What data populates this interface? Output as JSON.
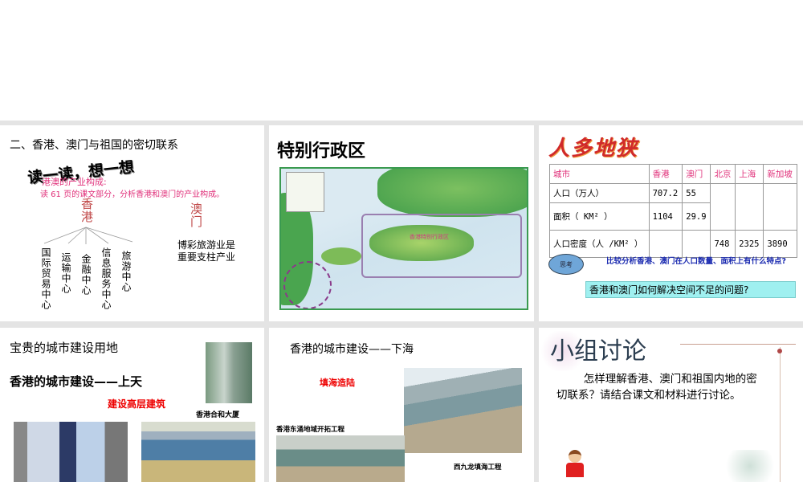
{
  "slides": [
    {
      "title": "二、香港、澳门与祖国的密切联系",
      "banner": "读一读，想一想",
      "subtitle": "港澳的产业构成:",
      "instruction": "读 61 页的课文部分，分析香港和澳门的产业构成。",
      "hk": "香港",
      "macau": "澳门",
      "hk_items": [
        "国际贸易中心",
        "运输中心",
        "金融中心",
        "信息服务中心",
        "旅游中心"
      ],
      "macau_text": "博彩旅游业是重要支柱产业"
    },
    {
      "title": "特别行政区",
      "map_label": "香港特别行政区"
    },
    {
      "title": "人多地狭",
      "table": {
        "headers": [
          "城市",
          "香港",
          "澳门",
          "北京",
          "上海",
          "新加坡"
        ],
        "rows": [
          [
            "人口（万人）",
            "707.2",
            "55",
            "",
            "",
            ""
          ],
          [
            "面积（ KM² ）",
            "1104",
            "29.9",
            "",
            "",
            ""
          ],
          [
            "人口密度（人 /KM² ）",
            "",
            "",
            "748",
            "2325",
            "3890"
          ]
        ]
      },
      "think_icon": "思考",
      "question1": "比较分析香港、澳门在人口数量、面积上有什么特点?",
      "question2": "香港和澳门如何解决空间不足的问题?"
    },
    {
      "title": "宝贵的城市建设用地",
      "subtitle": "香港的城市建设——上天",
      "red": "建设高层建筑",
      "caption": "香港合和大厦"
    },
    {
      "title": "香港的城市建设——下海",
      "red": "填海造陆",
      "caption1": "香港东涌地域开拓工程",
      "caption2": "西九龙填海工程"
    },
    {
      "title": "小组讨论",
      "body": "怎样理解香港、澳门和祖国内地的密切联系？请结合课文和材料进行讨论。"
    }
  ]
}
